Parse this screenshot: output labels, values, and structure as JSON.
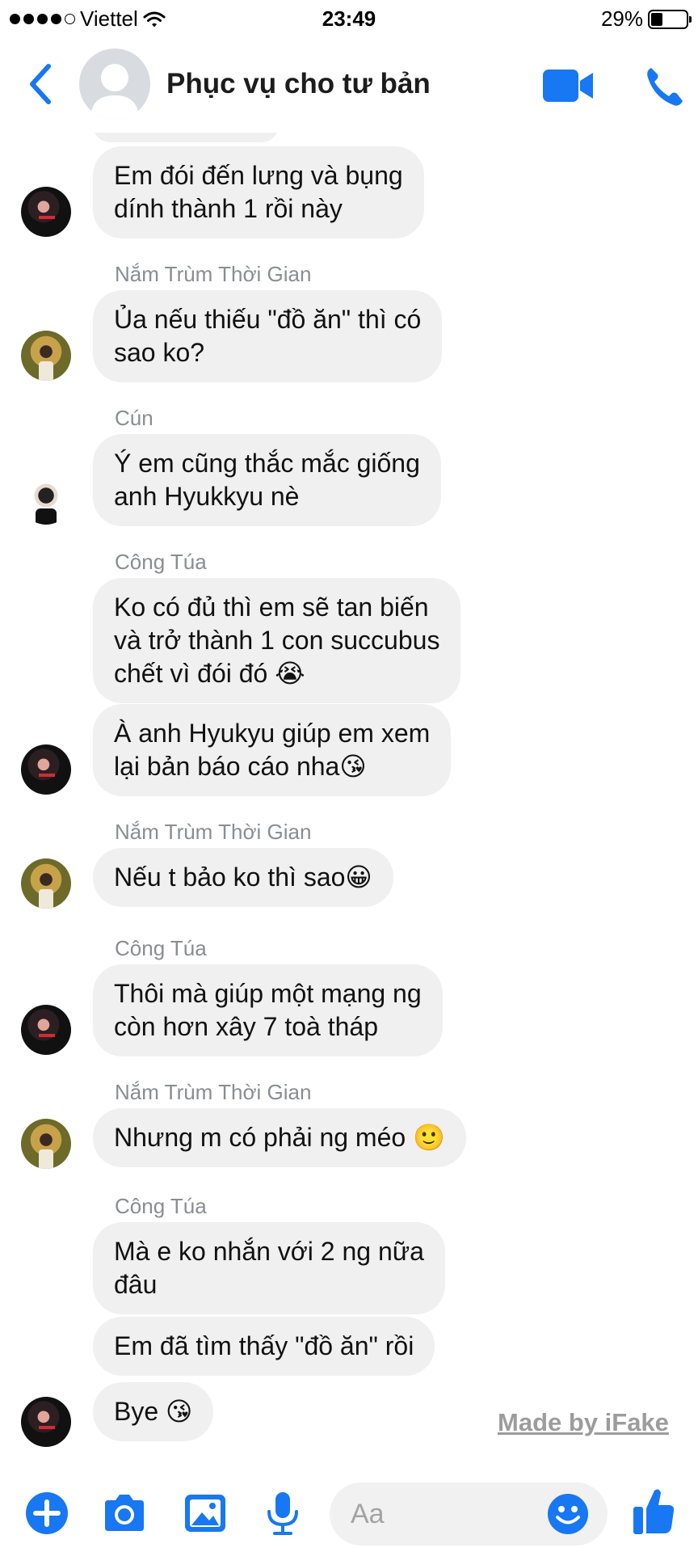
{
  "colors": {
    "accent": "#1877f2",
    "bubble": "#f1f0f0",
    "sender": "#8a8d91"
  },
  "status_bar": {
    "carrier": "Viettel",
    "time": "23:49",
    "battery": "29%"
  },
  "header": {
    "title": "Phục vụ cho tư bản"
  },
  "messages": [
    {
      "text": "Em đói đến lưng và bụng\ndính thành 1 rồi này"
    },
    {
      "sender": "Nắm Trùm Thời Gian",
      "text": "Ủa nếu thiếu \"đồ ăn\" thì có\nsao ko?"
    },
    {
      "sender": "Cún",
      "text": "Ý em cũng thắc mắc giống\nanh Hyukkyu nè"
    },
    {
      "sender": "Công Túa",
      "text": "Ko có đủ thì em sẽ tan biến\nvà trở thành 1 con succubus\nchết vì đói đó 😭"
    },
    {
      "text": "À anh Hyukyu giúp em xem\nlại bản báo cáo nha😘"
    },
    {
      "sender": "Nắm Trùm Thời Gian",
      "text": "Nếu t bảo ko thì sao😀"
    },
    {
      "sender": "Công Túa",
      "text": "Thôi mà giúp một mạng ng\ncòn hơn xây 7 toà tháp"
    },
    {
      "sender": "Nắm Trùm Thời Gian",
      "text": "Nhưng m có phải ng méo 🙂"
    },
    {
      "sender": "Công Túa",
      "text": "Mà e ko nhắn với 2 ng nữa\nđâu"
    },
    {
      "text": "Em đã tìm thấy \"đồ ăn\" rồi"
    },
    {
      "text": "Bye 😘"
    }
  ],
  "watermark": "Made by iFake",
  "composer": {
    "placeholder": "Aa"
  },
  "icons": [
    "back-chevron-icon",
    "video-call-icon",
    "phone-icon",
    "plus-icon",
    "camera-icon",
    "gallery-icon",
    "microphone-icon",
    "emoji-icon",
    "thumbs-up-icon"
  ]
}
